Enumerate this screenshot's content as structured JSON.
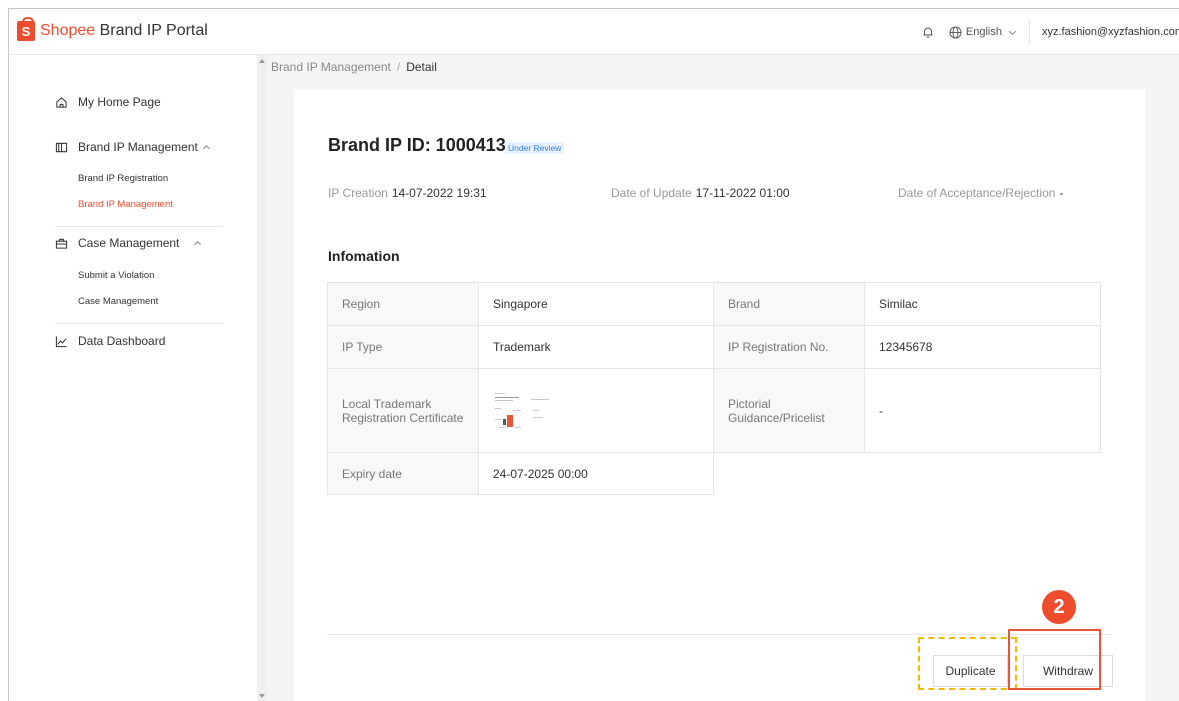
{
  "header": {
    "logo_brand": "Shopee",
    "logo_suffix": " Brand IP Portal",
    "language": "English",
    "user_email": "xyz.fashion@xyzfashion.com"
  },
  "sidebar": {
    "home": "My Home Page",
    "brand_ip_management": "Brand IP Management",
    "brand_ip_registration": "Brand IP Registration",
    "brand_ip_management_sub": "Brand IP Management",
    "case_management": "Case Management",
    "submit_violation": "Submit a Violation",
    "case_management_sub": "Case Management",
    "data_dashboard": "Data Dashboard"
  },
  "breadcrumb": {
    "parent": "Brand IP Management",
    "separator": "/",
    "current": "Detail"
  },
  "detail": {
    "title": "Brand IP ID: 1000413",
    "status": "Under Review",
    "ip_creation_label": "IP Creation",
    "ip_creation_value": "14-07-2022 19:31",
    "date_update_label": "Date of Update",
    "date_update_value": "17-11-2022 01:00",
    "date_accept_label": "Date of Acceptance/Rejection",
    "date_accept_value": "-",
    "section_title": "Infomation"
  },
  "info": {
    "region_label": "Region",
    "region_value": "Singapore",
    "brand_label": "Brand",
    "brand_value": "Similac",
    "ip_type_label": "IP Type",
    "ip_type_value": "Trademark",
    "ip_reg_no_label": "IP Registration No.",
    "ip_reg_no_value": "12345678",
    "local_cert_label_1": "Local Trademark",
    "local_cert_label_2": "Registration Certificate",
    "pictorial_label_1": "Pictorial",
    "pictorial_label_2": "Guidance/Pricelist",
    "pictorial_value": "-",
    "expiry_label": "Expiry date",
    "expiry_value": "24-07-2025 00:00"
  },
  "actions": {
    "duplicate": "Duplicate",
    "withdraw": "Withdraw"
  },
  "annotation": {
    "step_number": "2"
  },
  "colors": {
    "brand": "#ee4d2d",
    "status_blue": "#2f80ed",
    "highlight_yellow": "#f5b800",
    "highlight_red": "#e8553a"
  }
}
